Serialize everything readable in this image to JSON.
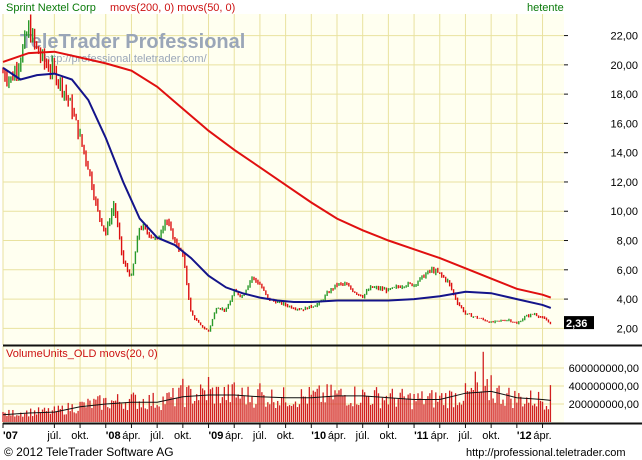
{
  "colors": {
    "background": "#ffffff",
    "plot_bg": "#fffff0",
    "grid": "#e9e29f",
    "up_bar": "#2a9a2a",
    "down_bar": "#dd1111",
    "ma200": "#e01010",
    "ma50": "#14148a",
    "volume_bar": "#d22020",
    "volume_ma": "#111111",
    "frame": "#111111",
    "title_text": "#cc1111",
    "period_text": "#0a7a0a",
    "watermark": "#9aa6b8",
    "price_tag_bg": "#000000",
    "price_tag_text": "#ffffff"
  },
  "header": {
    "symbol": "Sprint Nextel Corp",
    "indicators": "movs(200, 0) movs(50, 0)",
    "period": "hetente"
  },
  "watermark": {
    "brand_tele": "Tele",
    "brand_trader": "Trader",
    "brand_pro": "Professional",
    "url": "http://professional.teletrader.com/"
  },
  "last_price": "2,36",
  "volume_panel": {
    "title": "VolumeUnits_OLD movs(20, 0)"
  },
  "footer": {
    "copyright": "© 2012 TeleTrader Software AG",
    "url": "http://professional.teletrader.com"
  },
  "chart_data": [
    {
      "type": "line",
      "name": "price",
      "x_labels": [
        "'07",
        "júl.",
        "okt.",
        "'08",
        "ápr.",
        "júl.",
        "okt.",
        "'09",
        "ápr.",
        "júl.",
        "okt.",
        "'10",
        "ápr.",
        "júl.",
        "okt.",
        "'11",
        "ápr.",
        "júl.",
        "okt.",
        "'12",
        "ápr."
      ],
      "x_ticks": [
        2007.0,
        2007.5,
        2007.75,
        2008.0,
        2008.25,
        2008.5,
        2008.75,
        2009.0,
        2009.25,
        2009.5,
        2009.75,
        2010.0,
        2010.25,
        2010.5,
        2010.75,
        2011.0,
        2011.25,
        2011.5,
        2011.75,
        2012.0,
        2012.25
      ],
      "xlim": [
        2007.0,
        2012.42
      ],
      "y_ticks": [
        "2,00",
        "4,00",
        "6,00",
        "8,00",
        "10,00",
        "12,00",
        "14,00",
        "16,00",
        "18,00",
        "20,00",
        "22,00"
      ],
      "ylim": [
        1.0,
        23.2
      ],
      "grid": true,
      "series": [
        {
          "name": "Sprint Nextel Corp",
          "style": "ohlc",
          "x": [
            2007.0,
            2007.08,
            2007.17,
            2007.25,
            2007.33,
            2007.42,
            2007.5,
            2007.58,
            2007.67,
            2007.75,
            2007.83,
            2007.92,
            2008.0,
            2008.08,
            2008.17,
            2008.25,
            2008.33,
            2008.42,
            2008.5,
            2008.58,
            2008.67,
            2008.75,
            2008.83,
            2008.92,
            2009.0,
            2009.08,
            2009.17,
            2009.25,
            2009.33,
            2009.42,
            2009.5,
            2009.58,
            2009.67,
            2009.75,
            2009.83,
            2009.92,
            2010.0,
            2010.08,
            2010.17,
            2010.25,
            2010.33,
            2010.42,
            2010.5,
            2010.58,
            2010.67,
            2010.75,
            2010.83,
            2010.92,
            2011.0,
            2011.08,
            2011.17,
            2011.25,
            2011.33,
            2011.42,
            2011.5,
            2011.58,
            2011.67,
            2011.75,
            2011.83,
            2011.92,
            2012.0,
            2012.08,
            2012.17,
            2012.25,
            2012.33
          ],
          "y": [
            19.5,
            19.0,
            20.5,
            22.5,
            21.0,
            20.0,
            19.5,
            18.5,
            17.0,
            15.0,
            13.0,
            10.0,
            8.5,
            10.5,
            6.5,
            5.5,
            9.0,
            8.5,
            8.0,
            9.5,
            8.0,
            7.0,
            3.0,
            2.2,
            1.8,
            3.5,
            3.2,
            4.5,
            4.2,
            5.5,
            5.0,
            4.0,
            3.8,
            3.6,
            3.4,
            3.3,
            3.5,
            3.7,
            4.5,
            5.0,
            5.0,
            4.5,
            4.2,
            4.8,
            4.7,
            4.6,
            4.8,
            5.0,
            5.0,
            5.5,
            6.0,
            5.7,
            5.2,
            3.8,
            3.0,
            2.8,
            2.6,
            2.4,
            2.5,
            2.6,
            2.3,
            2.8,
            3.0,
            2.7,
            2.36
          ]
        },
        {
          "name": "movs(200, 0)",
          "style": "line",
          "x": [
            2007.0,
            2007.25,
            2007.5,
            2007.75,
            2008.0,
            2008.25,
            2008.5,
            2008.75,
            2009.0,
            2009.25,
            2009.5,
            2009.75,
            2010.0,
            2010.25,
            2010.5,
            2010.75,
            2011.0,
            2011.25,
            2011.5,
            2011.75,
            2012.0,
            2012.25,
            2012.33
          ],
          "y": [
            20.2,
            20.8,
            20.9,
            20.5,
            20.1,
            19.6,
            18.5,
            17.0,
            15.5,
            14.2,
            13.0,
            11.8,
            10.6,
            9.5,
            8.7,
            8.0,
            7.4,
            6.8,
            6.1,
            5.4,
            4.7,
            4.3,
            4.1
          ]
        },
        {
          "name": "movs(50, 0)",
          "style": "line",
          "x": [
            2007.0,
            2007.17,
            2007.33,
            2007.5,
            2007.67,
            2007.83,
            2008.0,
            2008.17,
            2008.33,
            2008.5,
            2008.67,
            2008.83,
            2009.0,
            2009.17,
            2009.33,
            2009.5,
            2009.67,
            2009.83,
            2010.0,
            2010.25,
            2010.5,
            2010.75,
            2011.0,
            2011.25,
            2011.5,
            2011.75,
            2012.0,
            2012.25,
            2012.33
          ],
          "y": [
            19.8,
            19.0,
            19.3,
            19.4,
            19.0,
            17.6,
            15.0,
            12.0,
            9.5,
            8.2,
            7.7,
            6.8,
            5.6,
            4.8,
            4.4,
            4.1,
            3.9,
            3.8,
            3.8,
            3.9,
            3.9,
            3.9,
            4.0,
            4.2,
            4.5,
            4.4,
            4.0,
            3.6,
            3.4
          ]
        }
      ]
    },
    {
      "type": "bar",
      "name": "volume",
      "title": "VolumeUnits_OLD movs(20, 0)",
      "y_ticks": [
        "200000000,00",
        "400000000,00",
        "600000000,00"
      ],
      "y_tick_values": [
        200000000,
        400000000,
        600000000
      ],
      "ylim": [
        0,
        800000000
      ],
      "series": [
        {
          "name": "VolumeUnits_OLD",
          "x": [
            2007.0,
            2007.25,
            2007.5,
            2007.75,
            2008.0,
            2008.25,
            2008.5,
            2008.75,
            2009.0,
            2009.25,
            2009.5,
            2009.75,
            2010.0,
            2010.25,
            2010.5,
            2010.75,
            2011.0,
            2011.25,
            2011.5,
            2011.75,
            2012.0,
            2012.25,
            2012.33
          ],
          "y": [
            90000000,
            110000000,
            120000000,
            180000000,
            220000000,
            240000000,
            230000000,
            290000000,
            320000000,
            300000000,
            280000000,
            270000000,
            280000000,
            300000000,
            290000000,
            270000000,
            250000000,
            260000000,
            300000000,
            340000000,
            260000000,
            250000000,
            240000000
          ],
          "peaks": [
            [
              2008.75,
              480000000
            ],
            [
              2009.0,
              500000000
            ],
            [
              2009.25,
              440000000
            ],
            [
              2009.5,
              430000000
            ],
            [
              2011.6,
              560000000
            ],
            [
              2011.68,
              780000000
            ],
            [
              2011.75,
              520000000
            ],
            [
              2012.33,
              410000000
            ]
          ]
        },
        {
          "name": "movs(20, 0)",
          "x": [
            2007.0,
            2007.25,
            2007.5,
            2007.75,
            2008.0,
            2008.25,
            2008.5,
            2008.75,
            2009.0,
            2009.25,
            2009.5,
            2009.75,
            2010.0,
            2010.25,
            2010.5,
            2010.75,
            2011.0,
            2011.25,
            2011.5,
            2011.75,
            2012.0,
            2012.25,
            2012.33
          ],
          "y": [
            80000000,
            100000000,
            110000000,
            170000000,
            200000000,
            220000000,
            220000000,
            280000000,
            300000000,
            300000000,
            280000000,
            270000000,
            270000000,
            290000000,
            290000000,
            270000000,
            250000000,
            250000000,
            320000000,
            340000000,
            270000000,
            250000000,
            240000000
          ]
        }
      ]
    }
  ]
}
